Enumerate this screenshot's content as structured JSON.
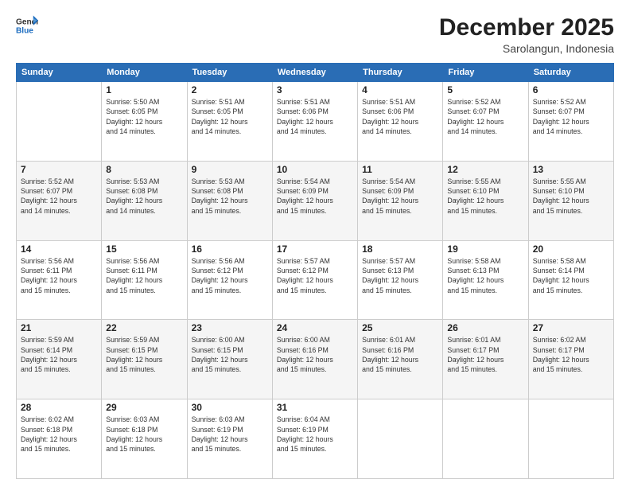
{
  "header": {
    "logo_line1": "General",
    "logo_line2": "Blue",
    "month": "December 2025",
    "location": "Sarolangun, Indonesia"
  },
  "weekdays": [
    "Sunday",
    "Monday",
    "Tuesday",
    "Wednesday",
    "Thursday",
    "Friday",
    "Saturday"
  ],
  "weeks": [
    [
      {
        "day": "",
        "info": ""
      },
      {
        "day": "1",
        "info": "Sunrise: 5:50 AM\nSunset: 6:05 PM\nDaylight: 12 hours\nand 14 minutes."
      },
      {
        "day": "2",
        "info": "Sunrise: 5:51 AM\nSunset: 6:05 PM\nDaylight: 12 hours\nand 14 minutes."
      },
      {
        "day": "3",
        "info": "Sunrise: 5:51 AM\nSunset: 6:06 PM\nDaylight: 12 hours\nand 14 minutes."
      },
      {
        "day": "4",
        "info": "Sunrise: 5:51 AM\nSunset: 6:06 PM\nDaylight: 12 hours\nand 14 minutes."
      },
      {
        "day": "5",
        "info": "Sunrise: 5:52 AM\nSunset: 6:07 PM\nDaylight: 12 hours\nand 14 minutes."
      },
      {
        "day": "6",
        "info": "Sunrise: 5:52 AM\nSunset: 6:07 PM\nDaylight: 12 hours\nand 14 minutes."
      }
    ],
    [
      {
        "day": "7",
        "info": "Sunrise: 5:52 AM\nSunset: 6:07 PM\nDaylight: 12 hours\nand 14 minutes."
      },
      {
        "day": "8",
        "info": "Sunrise: 5:53 AM\nSunset: 6:08 PM\nDaylight: 12 hours\nand 14 minutes."
      },
      {
        "day": "9",
        "info": "Sunrise: 5:53 AM\nSunset: 6:08 PM\nDaylight: 12 hours\nand 15 minutes."
      },
      {
        "day": "10",
        "info": "Sunrise: 5:54 AM\nSunset: 6:09 PM\nDaylight: 12 hours\nand 15 minutes."
      },
      {
        "day": "11",
        "info": "Sunrise: 5:54 AM\nSunset: 6:09 PM\nDaylight: 12 hours\nand 15 minutes."
      },
      {
        "day": "12",
        "info": "Sunrise: 5:55 AM\nSunset: 6:10 PM\nDaylight: 12 hours\nand 15 minutes."
      },
      {
        "day": "13",
        "info": "Sunrise: 5:55 AM\nSunset: 6:10 PM\nDaylight: 12 hours\nand 15 minutes."
      }
    ],
    [
      {
        "day": "14",
        "info": "Sunrise: 5:56 AM\nSunset: 6:11 PM\nDaylight: 12 hours\nand 15 minutes."
      },
      {
        "day": "15",
        "info": "Sunrise: 5:56 AM\nSunset: 6:11 PM\nDaylight: 12 hours\nand 15 minutes."
      },
      {
        "day": "16",
        "info": "Sunrise: 5:56 AM\nSunset: 6:12 PM\nDaylight: 12 hours\nand 15 minutes."
      },
      {
        "day": "17",
        "info": "Sunrise: 5:57 AM\nSunset: 6:12 PM\nDaylight: 12 hours\nand 15 minutes."
      },
      {
        "day": "18",
        "info": "Sunrise: 5:57 AM\nSunset: 6:13 PM\nDaylight: 12 hours\nand 15 minutes."
      },
      {
        "day": "19",
        "info": "Sunrise: 5:58 AM\nSunset: 6:13 PM\nDaylight: 12 hours\nand 15 minutes."
      },
      {
        "day": "20",
        "info": "Sunrise: 5:58 AM\nSunset: 6:14 PM\nDaylight: 12 hours\nand 15 minutes."
      }
    ],
    [
      {
        "day": "21",
        "info": "Sunrise: 5:59 AM\nSunset: 6:14 PM\nDaylight: 12 hours\nand 15 minutes."
      },
      {
        "day": "22",
        "info": "Sunrise: 5:59 AM\nSunset: 6:15 PM\nDaylight: 12 hours\nand 15 minutes."
      },
      {
        "day": "23",
        "info": "Sunrise: 6:00 AM\nSunset: 6:15 PM\nDaylight: 12 hours\nand 15 minutes."
      },
      {
        "day": "24",
        "info": "Sunrise: 6:00 AM\nSunset: 6:16 PM\nDaylight: 12 hours\nand 15 minutes."
      },
      {
        "day": "25",
        "info": "Sunrise: 6:01 AM\nSunset: 6:16 PM\nDaylight: 12 hours\nand 15 minutes."
      },
      {
        "day": "26",
        "info": "Sunrise: 6:01 AM\nSunset: 6:17 PM\nDaylight: 12 hours\nand 15 minutes."
      },
      {
        "day": "27",
        "info": "Sunrise: 6:02 AM\nSunset: 6:17 PM\nDaylight: 12 hours\nand 15 minutes."
      }
    ],
    [
      {
        "day": "28",
        "info": "Sunrise: 6:02 AM\nSunset: 6:18 PM\nDaylight: 12 hours\nand 15 minutes."
      },
      {
        "day": "29",
        "info": "Sunrise: 6:03 AM\nSunset: 6:18 PM\nDaylight: 12 hours\nand 15 minutes."
      },
      {
        "day": "30",
        "info": "Sunrise: 6:03 AM\nSunset: 6:19 PM\nDaylight: 12 hours\nand 15 minutes."
      },
      {
        "day": "31",
        "info": "Sunrise: 6:04 AM\nSunset: 6:19 PM\nDaylight: 12 hours\nand 15 minutes."
      },
      {
        "day": "",
        "info": ""
      },
      {
        "day": "",
        "info": ""
      },
      {
        "day": "",
        "info": ""
      }
    ]
  ]
}
